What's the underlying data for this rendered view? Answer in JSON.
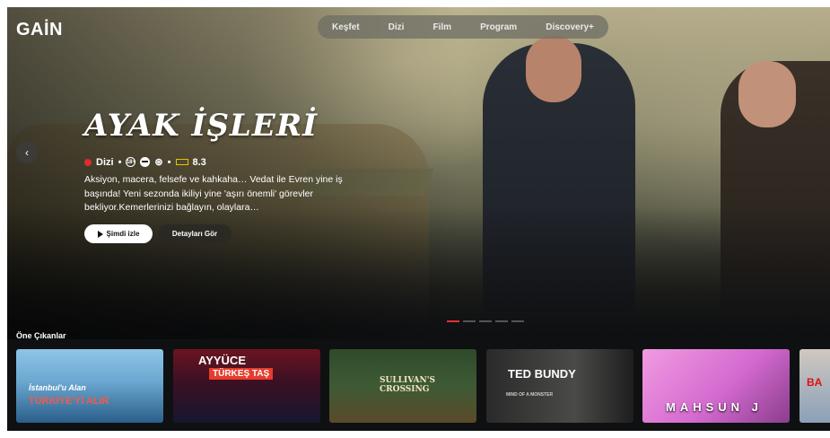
{
  "header": {
    "logo": "GAİN",
    "nav": [
      "Keşfet",
      "Dizi",
      "Film",
      "Program",
      "Discovery+"
    ]
  },
  "hero": {
    "title": "AYAK İŞLERİ",
    "type": "Dizi",
    "age_badge": "18+",
    "rating": "8.3",
    "description": "Aksiyon, macera, felsefe ve kahkaha… Vedat ile Evren yine iş başında! Yeni sezonda ikiliyi yine 'aşırı önemli' görevler bekliyor.Kemerlerinizi bağlayın, olaylara…",
    "watch_label": "Şimdi izle",
    "details_label": "Detayları Gör",
    "slide_indicator": {
      "active": 1,
      "total": 5
    }
  },
  "featured": {
    "title": "Öne Çıkanlar",
    "cards": [
      {
        "line1": "İstanbul'u Alan",
        "line2": "TÜRKİYE'Yİ ALIR"
      },
      {
        "line1": "AYYÜCE",
        "line2": "TÜRKEŞ TAŞ"
      },
      {
        "line1": "SULLIVAN'S CROSSING"
      },
      {
        "line1": "TED BUNDY",
        "line2": "MIND OF A MONSTER"
      },
      {
        "line1": "MAHSUN J"
      },
      {
        "line1": "BA"
      }
    ]
  },
  "colors": {
    "accent_red": "#e02b2b",
    "imdb_yellow": "#e8c400"
  }
}
